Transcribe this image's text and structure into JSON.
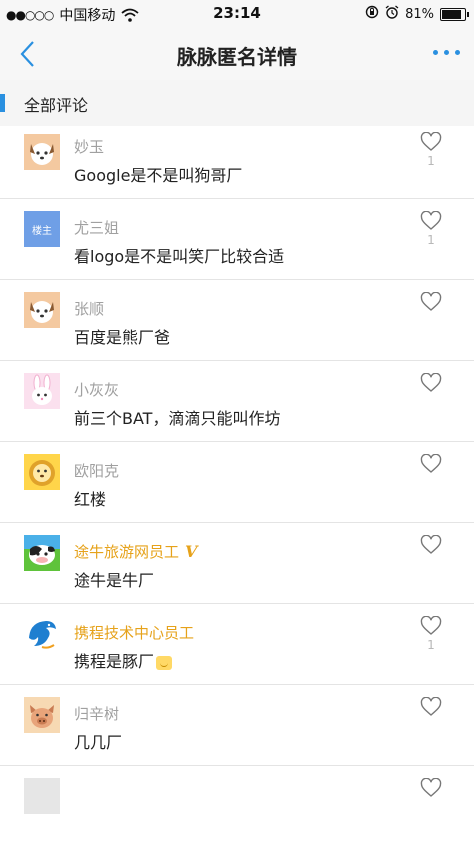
{
  "status_bar": {
    "signal": "●●○○○",
    "carrier": "中国移动",
    "time": "23:14",
    "battery": "81%",
    "battery_level": 0.81
  },
  "nav": {
    "title": "脉脉匿名详情"
  },
  "section": {
    "title": "全部评论"
  },
  "comments": [
    {
      "author": "妙玉",
      "text": "Google是不是叫狗哥厂",
      "likes": "1",
      "avatar": "dog-avatar"
    },
    {
      "author": "尤三姐",
      "text": "看logo是不是叫笑厂比较合适",
      "likes": "1",
      "avatar_label": "楼主",
      "avatar": "poster-avatar"
    },
    {
      "author": "张顺",
      "text": "百度是熊厂爸",
      "likes": "",
      "avatar": "dog-avatar"
    },
    {
      "author": "小灰灰",
      "text": "前三个BAT，滴滴只能叫作坊",
      "likes": "",
      "avatar": "rabbit-avatar"
    },
    {
      "author": "欧阳克",
      "text": "红楼",
      "likes": "",
      "avatar": "lion-avatar"
    },
    {
      "author": "途牛旅游网员工",
      "badge": "V",
      "text": "途牛是牛厂",
      "likes": "",
      "avatar": "tuniu-cow-logo"
    },
    {
      "author": "携程技术中心员工",
      "text": "携程是豚厂",
      "likes": "1",
      "avatar": "ctrip-dolphin-logo"
    },
    {
      "author": "归辛树",
      "text": "几几厂",
      "likes": "",
      "avatar": "pig-avatar"
    }
  ],
  "colors": {
    "accent": "#2a90e0",
    "employee": "#e6a21a",
    "muted": "#a0a0a0"
  }
}
